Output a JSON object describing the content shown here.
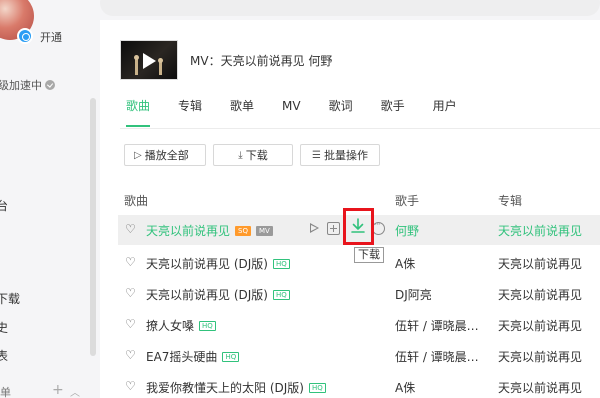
{
  "sidebar": {
    "open_vip": "开通",
    "accel": "级加速中",
    "items": [
      {
        "label": "台"
      },
      {
        "label": "下载"
      },
      {
        "label": "史"
      },
      {
        "label": "表"
      }
    ],
    "bottom_label": "单"
  },
  "mv": {
    "title": "MV：天亮以前说再见   何野"
  },
  "tabs": [
    "歌曲",
    "专辑",
    "歌单",
    "MV",
    "歌词",
    "歌手",
    "用户"
  ],
  "toolbar": {
    "play_all": "播放全部",
    "download": "下载",
    "batch": "批量操作"
  },
  "table": {
    "headers": {
      "song": "歌曲",
      "singer": "歌手",
      "album": "专辑"
    },
    "rows": [
      {
        "name": "天亮以前说再见",
        "badges": [
          "SQ",
          "MV"
        ],
        "singer": "何野",
        "album": "天亮以前说再见"
      },
      {
        "name": "天亮以前说再见 (DJ版)",
        "badges": [
          "HQ"
        ],
        "singer": "A侏",
        "album": "天亮以前说再见"
      },
      {
        "name": "天亮以前说再见 (DJ版)",
        "badges": [
          "HQ"
        ],
        "singer": "DJ阿亮",
        "album": "天亮以前说再见"
      },
      {
        "name": "撩人女嗓",
        "badges": [
          "HQ"
        ],
        "singer": "伍轩 / 谭晓晨…",
        "album": "天亮以前说再见"
      },
      {
        "name": "EA7摇头硬曲",
        "badges": [
          "HQ"
        ],
        "singer": "伍轩 / 谭晓晨…",
        "album": "天亮以前说再见"
      },
      {
        "name": "我爱你教懂天上的太阳 (DJ版)",
        "badges": [
          "HQ"
        ],
        "singer": "A侏",
        "album": "天亮以前说再见"
      }
    ]
  },
  "tooltip": "下载",
  "colors": {
    "accent": "#31c27c",
    "highlight": "#e8141c"
  }
}
